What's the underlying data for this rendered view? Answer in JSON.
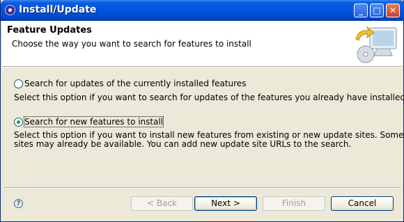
{
  "window": {
    "title": "Install/Update",
    "icon": "eclipse-icon",
    "controls": {
      "minimize": "_",
      "maximize": "□",
      "close": "✕"
    }
  },
  "header": {
    "title": "Feature Updates",
    "description": "Choose the way you want to search for features to install",
    "image": "update-wizard-icon"
  },
  "options": [
    {
      "label": "Search for updates of the currently installed features",
      "checked": false,
      "description": [
        "Select this option if you want to search for updates of the features you already have installed."
      ]
    },
    {
      "label": "Search for new features to install",
      "checked": true,
      "description": [
        "Select this option if you want to install new features from existing or new update sites. Some",
        "sites may already be available. You can add new update site URLs to the search."
      ]
    }
  ],
  "footer": {
    "help_icon": "help-icon",
    "help_text": "?",
    "back_label": "< Back",
    "next_label": "Next >",
    "finish_label": "Finish",
    "cancel_label": "Cancel"
  }
}
